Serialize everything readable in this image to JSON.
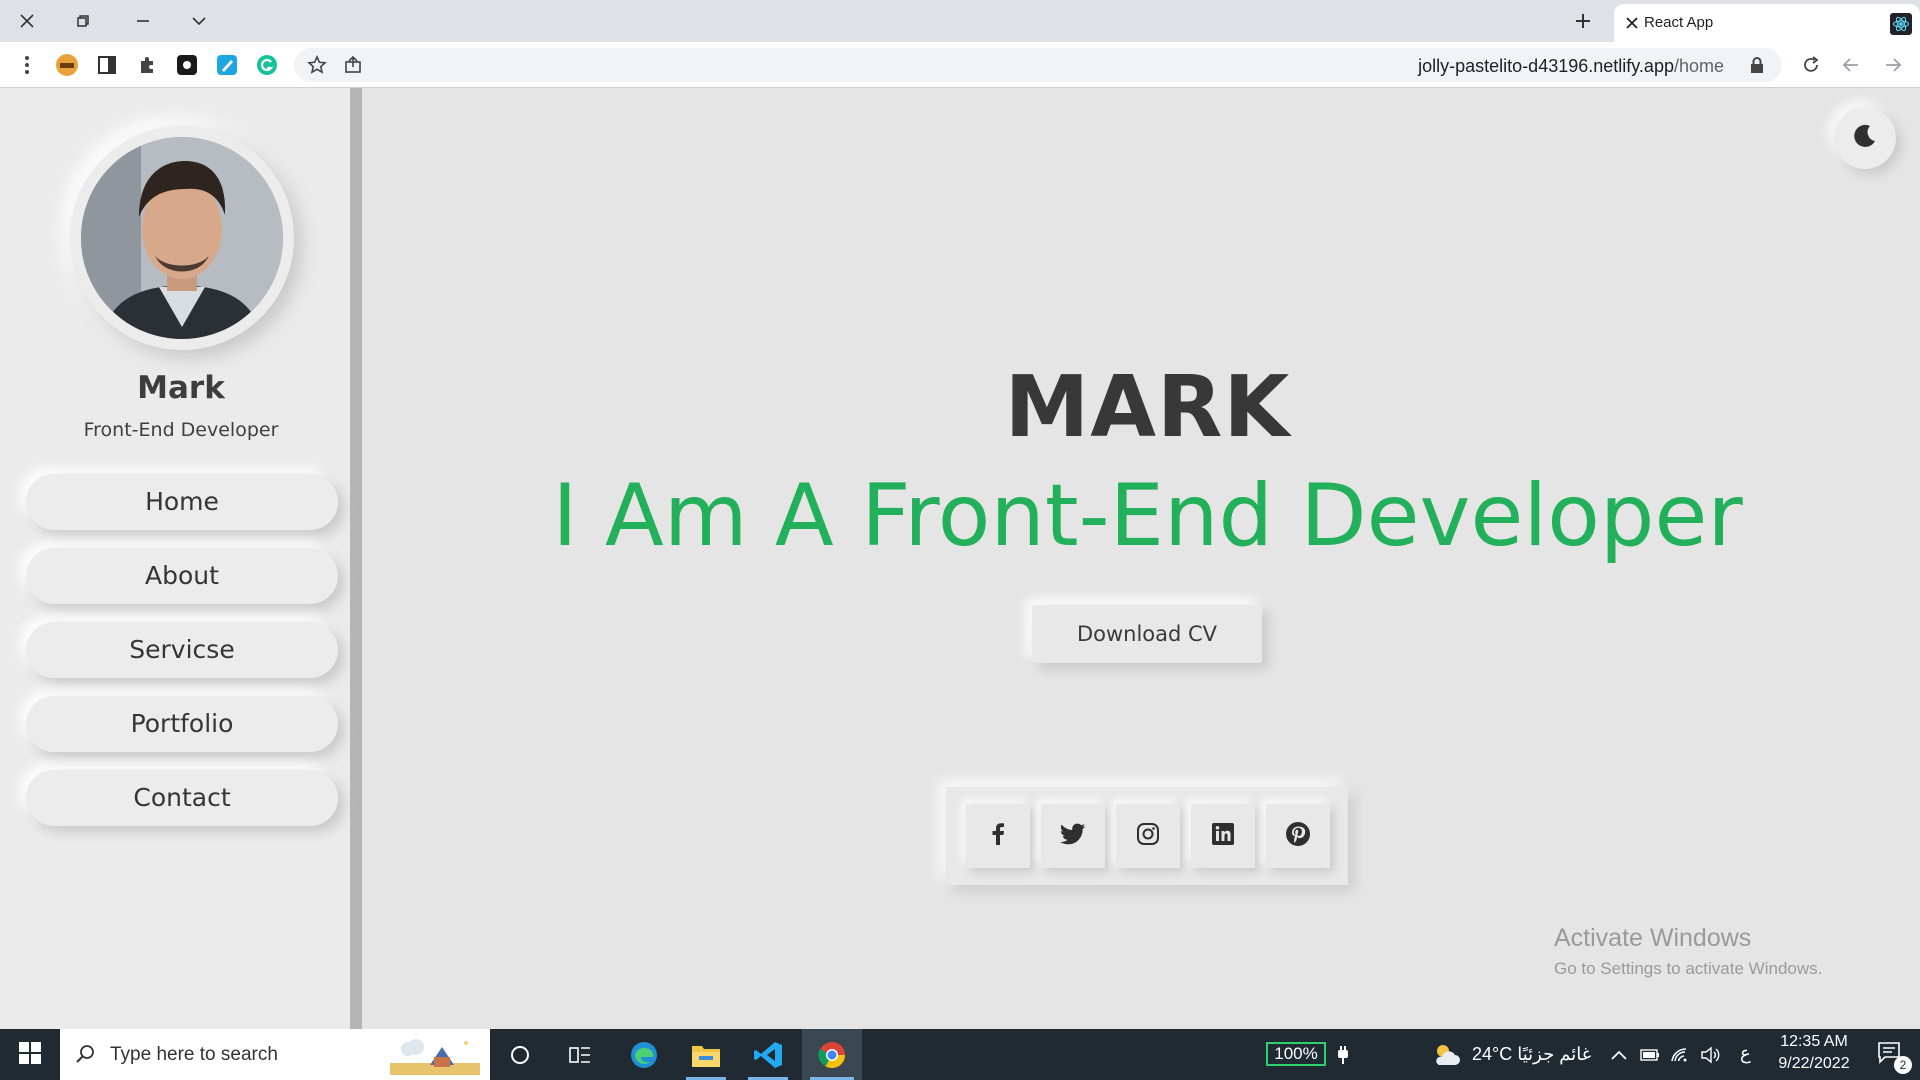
{
  "browser": {
    "tab_title": "React App",
    "url_domain": "jolly-pastelito-d43196.netlify.app",
    "url_path": "/home"
  },
  "profile": {
    "name": "Mark",
    "role": "Front-End Developer"
  },
  "nav": {
    "items": [
      {
        "label": "Home"
      },
      {
        "label": "About"
      },
      {
        "label": "Servicse"
      },
      {
        "label": "Portfolio"
      },
      {
        "label": "Contact"
      }
    ]
  },
  "hero": {
    "name": "MARK",
    "tagline": "I Am A Front-End Developer",
    "download_label": "Download CV"
  },
  "social": {
    "icons": [
      "facebook-icon",
      "twitter-icon",
      "instagram-icon",
      "linkedin-icon",
      "pinterest-icon"
    ]
  },
  "watermark": {
    "line1": "Activate Windows",
    "line2": "Go to Settings to activate Windows."
  },
  "taskbar": {
    "search_placeholder": "Type here to search",
    "battery": "100%",
    "weather": "24°C  غائم جزئيًا",
    "lang": "ع",
    "time": "12:35 AM",
    "date": "9/22/2022",
    "notifications": "2"
  },
  "colors": {
    "accent": "#23b05a",
    "page_bg": "#e5e5e5",
    "sidebar_border": "#b5b5b5"
  }
}
